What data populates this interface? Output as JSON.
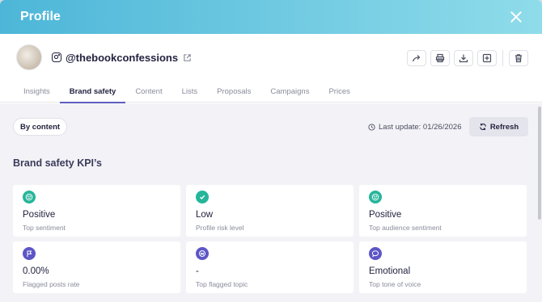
{
  "header": {
    "title": "Profile"
  },
  "profile": {
    "handle": "@thebookconfessions"
  },
  "tabs": [
    {
      "label": "Insights",
      "active": false
    },
    {
      "label": "Brand safety",
      "active": true
    },
    {
      "label": "Content",
      "active": false
    },
    {
      "label": "Lists",
      "active": false
    },
    {
      "label": "Proposals",
      "active": false
    },
    {
      "label": "Campaigns",
      "active": false
    },
    {
      "label": "Prices",
      "active": false
    }
  ],
  "filter": {
    "label": "By content"
  },
  "update": {
    "text": "Last update: 01/26/2026",
    "refresh_label": "Refresh"
  },
  "section": {
    "title": "Brand safety KPI’s"
  },
  "kpis": [
    {
      "value": "Positive",
      "label": "Top sentiment",
      "icon": "smile-icon",
      "color": "#26b59a"
    },
    {
      "value": "Low",
      "label": "Profile risk level",
      "icon": "check-icon",
      "color": "#26b59a"
    },
    {
      "value": "Positive",
      "label": "Top audience sentiment",
      "icon": "smile-icon",
      "color": "#26b59a"
    },
    {
      "value": "0.00%",
      "label": "Flagged posts rate",
      "icon": "flag-icon",
      "color": "#5d56c6"
    },
    {
      "value": "-",
      "label": "Top flagged topic",
      "icon": "topic-icon",
      "color": "#5d56c6"
    },
    {
      "value": "Emotional",
      "label": "Top tone of voice",
      "icon": "speech-bubble-icon",
      "color": "#5d56c6"
    }
  ],
  "colors": {
    "header_gradient_start": "#4db6d8",
    "header_gradient_end": "#8fdcea",
    "active_tab_underline": "#5f5fbf"
  }
}
